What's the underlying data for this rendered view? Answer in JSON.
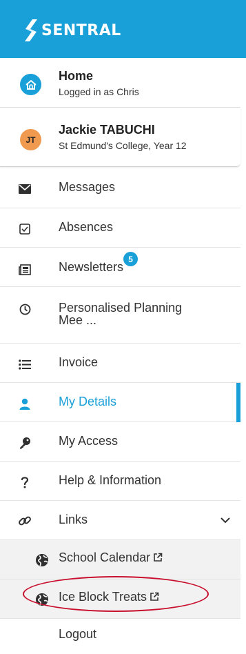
{
  "brand": {
    "name": "SENTRAL",
    "header_color": "#1aa0d8"
  },
  "home": {
    "title": "Home",
    "subtitle": "Logged in as Chris",
    "icon": "home-icon"
  },
  "student": {
    "initials": "JT",
    "name": "Jackie TABUCHI",
    "subtitle": "St Edmund's College, Year 12",
    "avatar_color": "#ef9a4e"
  },
  "nav": {
    "messages": {
      "label": "Messages",
      "icon": "envelope-icon"
    },
    "absences": {
      "label": "Absences",
      "icon": "checkbox-icon"
    },
    "newsletters": {
      "label": "Newsletters",
      "icon": "newspaper-icon",
      "badge": "5"
    },
    "planning": {
      "label_line1": "Personalised Planning",
      "label_line2": "Mee ...",
      "icon": "clock-icon"
    },
    "invoice": {
      "label": "Invoice",
      "icon": "list-icon"
    },
    "my_details": {
      "label": "My Details",
      "icon": "user-icon",
      "active": true
    },
    "my_access": {
      "label": "My Access",
      "icon": "key-icon"
    },
    "help": {
      "label": "Help & Information",
      "icon": "question-icon"
    },
    "links": {
      "label": "Links",
      "icon": "link-icon",
      "expanded": true
    }
  },
  "links": {
    "school_calendar": {
      "label": "School Calendar",
      "icon": "globe-icon"
    },
    "ice_block_treats": {
      "label": "Ice Block Treats",
      "icon": "globe-icon"
    }
  },
  "logout": {
    "label": "Logout"
  },
  "colors": {
    "accent": "#1aa0d8",
    "highlight": "#c8102e"
  }
}
